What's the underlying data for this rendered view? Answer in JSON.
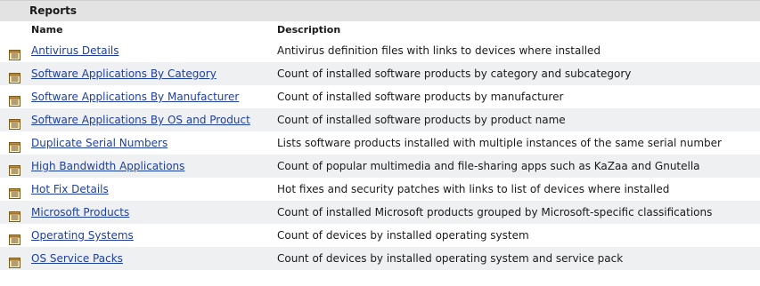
{
  "panel": {
    "title": "Reports",
    "columns": {
      "name": "Name",
      "description": "Description"
    }
  },
  "reports": [
    {
      "name": "Antivirus Details",
      "description": "Antivirus definition files with links to devices where installed",
      "icon": "report-icon"
    },
    {
      "name": "Software Applications By Category",
      "description": "Count of installed software products by category and subcategory",
      "icon": "report-icon"
    },
    {
      "name": "Software Applications By Manufacturer",
      "description": "Count of installed software products by manufacturer",
      "icon": "report-icon"
    },
    {
      "name": "Software Applications By OS and Product",
      "description": "Count of installed software products by product name",
      "icon": "report-icon"
    },
    {
      "name": "Duplicate Serial Numbers",
      "description": "Lists software products installed with multiple instances of the same serial number",
      "icon": "report-icon"
    },
    {
      "name": "High Bandwidth Applications",
      "description": "Count of popular multimedia and file-sharing apps such as KaZaa and Gnutella",
      "icon": "report-icon"
    },
    {
      "name": "Hot Fix Details",
      "description": "Hot fixes and security patches with links to list of devices where installed",
      "icon": "report-icon"
    },
    {
      "name": "Microsoft Products",
      "description": "Count of installed Microsoft products grouped by Microsoft-specific classifications",
      "icon": "report-icon"
    },
    {
      "name": "Operating Systems",
      "description": "Count of devices by installed operating system",
      "icon": "report-icon"
    },
    {
      "name": "OS Service Packs",
      "description": "Count of devices by installed operating system and service pack",
      "icon": "report-icon"
    }
  ],
  "colors": {
    "link": "#1f3f9f",
    "title_bar": "#e3e3e3",
    "alt_row": "#eef0f2"
  }
}
